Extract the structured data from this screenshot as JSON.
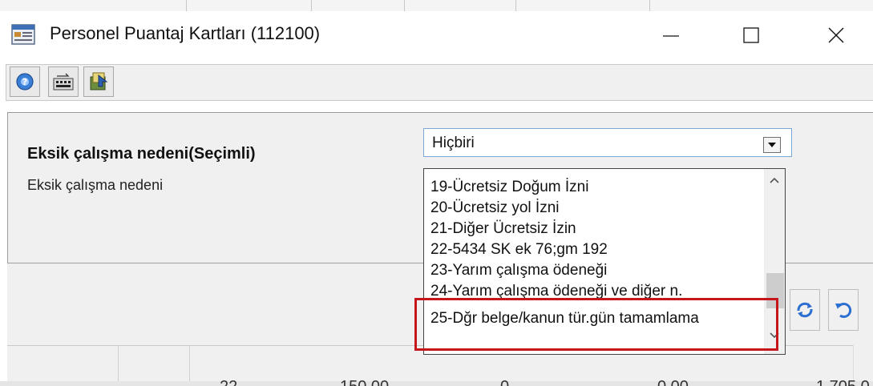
{
  "window": {
    "title": "Personel Puantaj Kartları (112100)",
    "icon": "calendar-card-icon"
  },
  "window_controls": {
    "minimize_icon": "minimize-icon",
    "maximize_icon": "maximize-icon",
    "close_icon": "close-icon"
  },
  "toolbar": {
    "buttons": [
      {
        "name": "help",
        "icon": "help-icon"
      },
      {
        "name": "calculator",
        "icon": "calculator-icon"
      },
      {
        "name": "export",
        "icon": "export-icon"
      }
    ]
  },
  "form": {
    "bold_label": "Eksik çalışma nedeni(Seçimli)",
    "label": "Eksik çalışma nedeni",
    "combo": {
      "value": "Hiçbiri",
      "options": [
        "19-Ücretsiz Doğum İzni",
        "20-Ücretsiz yol İzni",
        "21-Diğer Ücretsiz İzin",
        "22-5434 SK ek 76;gm 192",
        "23-Yarım çalışma ödeneği",
        "24-Yarım çalışma ödeneği ve diğer n.",
        "25-Dğr belge/kanun tür.gün tamamlama"
      ],
      "highlighted_option_index": 6
    }
  },
  "nav": {
    "refresh_icon": "refresh-icon",
    "undo_icon": "undo-icon"
  },
  "background_row": {
    "values": [
      "22",
      "150,00",
      "0",
      "0,00",
      "1.705,0"
    ]
  },
  "colors": {
    "highlight": "#c4161c",
    "combo_border": "#7aa7d8",
    "panel_bg": "#f0f0f0"
  }
}
